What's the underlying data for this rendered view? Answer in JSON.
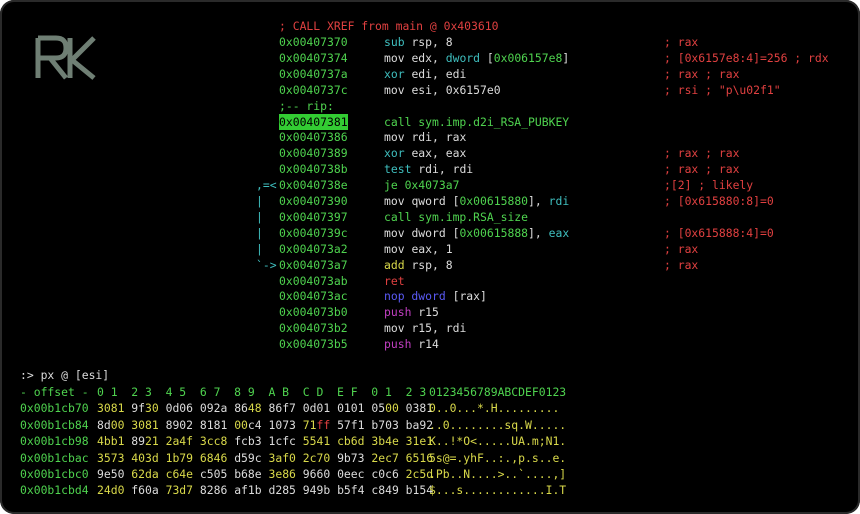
{
  "colors": {
    "green": "#4fd34f",
    "blue": "#5a5af5",
    "cyan": "#3fbfbf",
    "red": "#e04040",
    "magenta": "#c23fc2",
    "yellow": "#d9d94a",
    "white": "#dcdcdc"
  },
  "logo_icon": "rk-logo-icon",
  "disasm": {
    "xref_comment": "; CALL XREF from main @ 0x403610",
    "rip_label": ";-- rip:",
    "lines": [
      {
        "flow": "",
        "addr": "0x00407370",
        "mnem": "sub",
        "mcolor": "cyan",
        "ops": [
          {
            "t": "rsp, 8",
            "c": "white"
          }
        ],
        "comment": "; rax"
      },
      {
        "flow": "",
        "addr": "0x00407374",
        "mnem": "mov",
        "mcolor": "white",
        "ops": [
          {
            "t": "edx, ",
            "c": "white"
          },
          {
            "t": "dword",
            "c": "cyan"
          },
          {
            "t": " [",
            "c": "white"
          },
          {
            "t": "0x006157e8",
            "c": "green"
          },
          {
            "t": "]",
            "c": "white"
          }
        ],
        "comment": "; [0x6157e8:4]=256 ; rdx"
      },
      {
        "flow": "",
        "addr": "0x0040737a",
        "mnem": "xor",
        "mcolor": "cyan",
        "ops": [
          {
            "t": "edi, edi",
            "c": "white"
          }
        ],
        "comment": "; rax ; rax"
      },
      {
        "flow": "",
        "addr": "0x0040737c",
        "mnem": "mov",
        "mcolor": "white",
        "ops": [
          {
            "t": "esi, 0x6157e0",
            "c": "white"
          }
        ],
        "comment": "; rsi ; \"p\\u02f1\""
      },
      {
        "flow": "",
        "addr": "0x00407381",
        "mnem": "call sym.imp.d2i_RSA_PUBKEY",
        "mcolor": "green",
        "ops": [],
        "comment": "",
        "current": true
      },
      {
        "flow": "",
        "addr": "0x00407386",
        "mnem": "mov",
        "mcolor": "white",
        "ops": [
          {
            "t": "rdi, rax",
            "c": "white"
          }
        ],
        "comment": ""
      },
      {
        "flow": "",
        "addr": "0x00407389",
        "mnem": "xor",
        "mcolor": "cyan",
        "ops": [
          {
            "t": "eax, eax",
            "c": "white"
          }
        ],
        "comment": "; rax ; rax"
      },
      {
        "flow": "",
        "addr": "0x0040738b",
        "mnem": "test",
        "mcolor": "cyan",
        "ops": [
          {
            "t": "rdi, rdi",
            "c": "white"
          }
        ],
        "comment": "; rax ; rax"
      },
      {
        "flow": ",=<",
        "addr": "0x0040738e",
        "mnem": "je",
        "mcolor": "green",
        "ops": [
          {
            "t": "0x4073a7",
            "c": "green"
          }
        ],
        "comment": ";[2] ; likely"
      },
      {
        "flow": "|",
        "addr": "0x00407390",
        "mnem": "mov",
        "mcolor": "white",
        "ops": [
          {
            "t": "qword",
            "c": "white"
          },
          {
            "t": " [",
            "c": "white"
          },
          {
            "t": "0x00615880",
            "c": "green"
          },
          {
            "t": "], ",
            "c": "white"
          },
          {
            "t": "rdi",
            "c": "cyan"
          }
        ],
        "comment": "; [0x615880:8]=0"
      },
      {
        "flow": "|",
        "addr": "0x00407397",
        "mnem": "call sym.imp.RSA_size",
        "mcolor": "green",
        "ops": [],
        "comment": ""
      },
      {
        "flow": "|",
        "addr": "0x0040739c",
        "mnem": "mov",
        "mcolor": "white",
        "ops": [
          {
            "t": "dword",
            "c": "white"
          },
          {
            "t": " [",
            "c": "white"
          },
          {
            "t": "0x00615888",
            "c": "green"
          },
          {
            "t": "], ",
            "c": "white"
          },
          {
            "t": "eax",
            "c": "cyan"
          }
        ],
        "comment": "; [0x615888:4]=0"
      },
      {
        "flow": "|",
        "addr": "0x004073a2",
        "mnem": "mov",
        "mcolor": "white",
        "ops": [
          {
            "t": "eax, 1",
            "c": "white"
          }
        ],
        "comment": "; rax"
      },
      {
        "flow": "`->",
        "addr": "0x004073a7",
        "mnem": "add",
        "mcolor": "yellow",
        "ops": [
          {
            "t": "rsp, 8",
            "c": "white"
          }
        ],
        "comment": "; rax"
      },
      {
        "flow": "",
        "addr": "0x004073ab",
        "mnem": "ret",
        "mcolor": "red",
        "ops": [],
        "comment": ""
      },
      {
        "flow": "",
        "addr": "0x004073ac",
        "mnem": "nop dword",
        "mcolor": "blue",
        "ops": [
          {
            "t": " [rax]",
            "c": "white"
          }
        ],
        "comment": ""
      },
      {
        "flow": "",
        "addr": "0x004073b0",
        "mnem": "push",
        "mcolor": "magenta",
        "ops": [
          {
            "t": "r15",
            "c": "white"
          }
        ],
        "comment": ""
      },
      {
        "flow": "",
        "addr": "0x004073b2",
        "mnem": "mov",
        "mcolor": "white",
        "ops": [
          {
            "t": "r15, rdi",
            "c": "white"
          }
        ],
        "comment": ""
      },
      {
        "flow": "",
        "addr": "0x004073b5",
        "mnem": "push",
        "mcolor": "magenta",
        "ops": [
          {
            "t": "r14",
            "c": "white"
          }
        ],
        "comment": ""
      }
    ]
  },
  "hexdump": {
    "prompt": ":> px @ [esi]",
    "header": {
      "offset": "- offset -",
      "cols": "0 1  2 3  4 5  6 7  8 9  A B  C D  E F  0 1  2 3",
      "ascii": "0123456789ABCDEF0123"
    },
    "rows": [
      {
        "offset": "0x00b1cb70",
        "words": [
          [
            {
              "t": "3081",
              "c": "yellow"
            }
          ],
          [
            {
              "t": "9f",
              "c": "white"
            },
            {
              "t": "30",
              "c": "yellow"
            }
          ],
          [
            {
              "t": "0d06",
              "c": "white"
            }
          ],
          [
            {
              "t": "092a",
              "c": "white"
            }
          ],
          [
            {
              "t": "86",
              "c": "white"
            },
            {
              "t": "48",
              "c": "yellow"
            }
          ],
          [
            {
              "t": "86f7",
              "c": "white"
            }
          ],
          [
            {
              "t": "0d01",
              "c": "white"
            }
          ],
          [
            {
              "t": "0101",
              "c": "white"
            }
          ],
          [
            {
              "t": "05",
              "c": "white"
            },
            {
              "t": "00",
              "c": "yellow"
            }
          ],
          [
            {
              "t": "0381",
              "c": "white"
            }
          ]
        ],
        "ascii": "0..0...*.H........."
      },
      {
        "offset": "0x00b1cb84",
        "words": [
          [
            {
              "t": "8d",
              "c": "white"
            },
            {
              "t": "00",
              "c": "yellow"
            }
          ],
          [
            {
              "t": "3081",
              "c": "yellow"
            }
          ],
          [
            {
              "t": "8902",
              "c": "white"
            }
          ],
          [
            {
              "t": "8181",
              "c": "white"
            }
          ],
          [
            {
              "t": "00",
              "c": "yellow"
            },
            {
              "t": "c4",
              "c": "white"
            }
          ],
          [
            {
              "t": "1073",
              "c": "white"
            }
          ],
          [
            {
              "t": "71",
              "c": "yellow"
            },
            {
              "t": "ff",
              "c": "red"
            }
          ],
          [
            {
              "t": "57f1",
              "c": "white"
            }
          ],
          [
            {
              "t": "b703",
              "c": "white"
            }
          ],
          [
            {
              "t": "ba92",
              "c": "white"
            }
          ]
        ],
        "ascii": "..0........sq.W....."
      },
      {
        "offset": "0x00b1cb98",
        "words": [
          [
            {
              "t": "4bb1",
              "c": "yellow"
            }
          ],
          [
            {
              "t": "89",
              "c": "white"
            },
            {
              "t": "21",
              "c": "yellow"
            }
          ],
          [
            {
              "t": "2a4f",
              "c": "yellow"
            }
          ],
          [
            {
              "t": "3cc8",
              "c": "yellow"
            }
          ],
          [
            {
              "t": "fcb3",
              "c": "white"
            }
          ],
          [
            {
              "t": "1cfc",
              "c": "white"
            }
          ],
          [
            {
              "t": "5541",
              "c": "yellow"
            }
          ],
          [
            {
              "t": "cb6d",
              "c": "yellow"
            }
          ],
          [
            {
              "t": "3b4e",
              "c": "yellow"
            }
          ],
          [
            {
              "t": "31e1",
              "c": "yellow"
            }
          ]
        ],
        "ascii": "K..!*O<.....UA.m;N1."
      },
      {
        "offset": "0x00b1cbac",
        "words": [
          [
            {
              "t": "3573",
              "c": "yellow"
            }
          ],
          [
            {
              "t": "403d",
              "c": "yellow"
            }
          ],
          [
            {
              "t": "1b79",
              "c": "yellow"
            }
          ],
          [
            {
              "t": "6846",
              "c": "yellow"
            }
          ],
          [
            {
              "t": "d59c",
              "c": "white"
            }
          ],
          [
            {
              "t": "3af0",
              "c": "yellow"
            }
          ],
          [
            {
              "t": "2c70",
              "c": "yellow"
            }
          ],
          [
            {
              "t": "9b73",
              "c": "white"
            }
          ],
          [
            {
              "t": "2ec7",
              "c": "yellow"
            }
          ],
          [
            {
              "t": "6516",
              "c": "yellow"
            }
          ]
        ],
        "ascii": "5s@=.yhF..:.,p.s..e."
      },
      {
        "offset": "0x00b1cbc0",
        "words": [
          [
            {
              "t": "9e50",
              "c": "white"
            }
          ],
          [
            {
              "t": "62da",
              "c": "yellow"
            }
          ],
          [
            {
              "t": "c64e",
              "c": "yellow"
            }
          ],
          [
            {
              "t": "c505",
              "c": "white"
            }
          ],
          [
            {
              "t": "b68e",
              "c": "white"
            }
          ],
          [
            {
              "t": "3e86",
              "c": "yellow"
            }
          ],
          [
            {
              "t": "9660",
              "c": "white"
            }
          ],
          [
            {
              "t": "0eec",
              "c": "white"
            }
          ],
          [
            {
              "t": "c0c6",
              "c": "white"
            }
          ],
          [
            {
              "t": "2c5d",
              "c": "yellow"
            }
          ]
        ],
        "ascii": ".Pb..N....>..`....,]"
      },
      {
        "offset": "0x00b1cbd4",
        "words": [
          [
            {
              "t": "24d0",
              "c": "yellow"
            }
          ],
          [
            {
              "t": "f60a",
              "c": "white"
            }
          ],
          [
            {
              "t": "73d7",
              "c": "yellow"
            }
          ],
          [
            {
              "t": "8286",
              "c": "white"
            }
          ],
          [
            {
              "t": "af1b",
              "c": "white"
            }
          ],
          [
            {
              "t": "d285",
              "c": "white"
            }
          ],
          [
            {
              "t": "949b",
              "c": "white"
            }
          ],
          [
            {
              "t": "b5f4",
              "c": "white"
            }
          ],
          [
            {
              "t": "c849",
              "c": "white"
            }
          ],
          [
            {
              "t": "b154",
              "c": "white"
            }
          ]
        ],
        "ascii": "$...s............I.T"
      }
    ]
  }
}
